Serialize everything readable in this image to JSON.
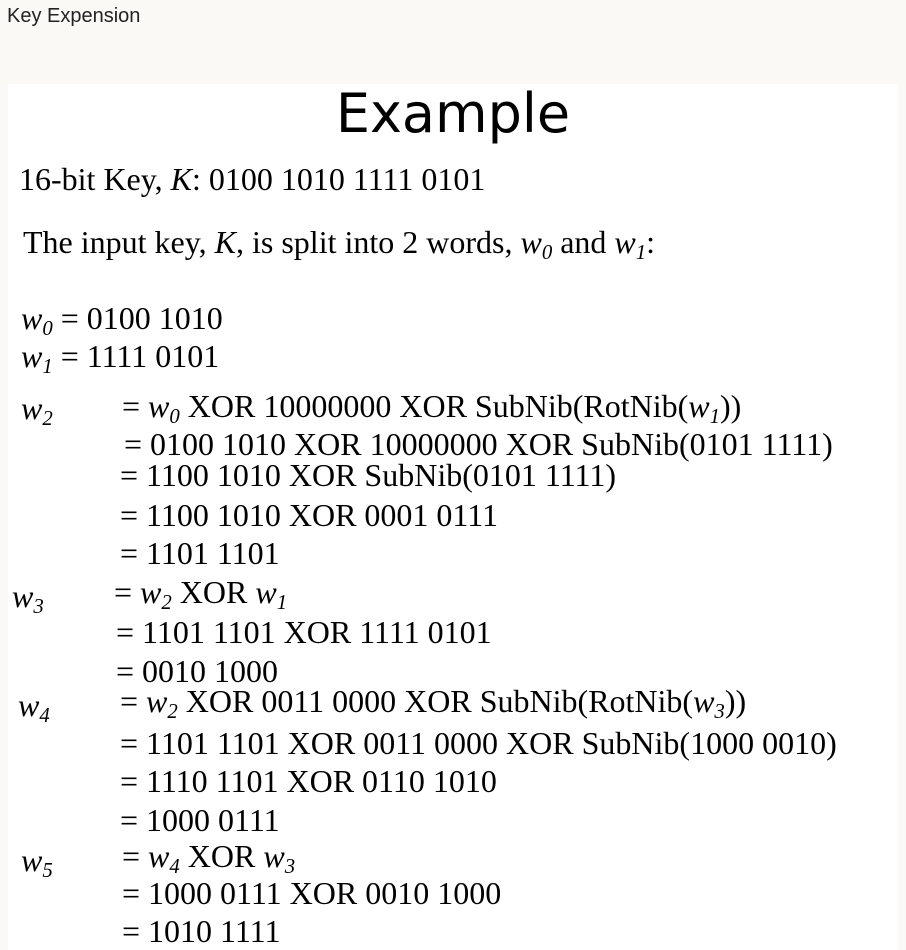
{
  "header": {
    "title": "Key Expension"
  },
  "slide": {
    "title": "Example",
    "key_line": {
      "prefix": "16-bit Key, ",
      "var": "K",
      "value": ": 0100 1010 1111 0101"
    },
    "split_line": {
      "p1": "The input key, ",
      "var_k": "K",
      "p2": ", is split into 2 words, ",
      "w0_base": "w",
      "w0_sub": "0",
      "p3": " and ",
      "w1_base": "w",
      "w1_sub": "1",
      "p4": ":"
    },
    "w0_def": {
      "base": "w",
      "sub": "0",
      "value": " = 0100 1010"
    },
    "w1_def": {
      "base": "w",
      "sub": "1",
      "value": " = 1111 0101"
    },
    "w2": {
      "label_base": "w",
      "label_sub": "2",
      "line1": {
        "a": "= ",
        "v1_base": "w",
        "v1_sub": "0",
        "b": " XOR 10000000 XOR SubNib(RotNib(",
        "v2_base": "w",
        "v2_sub": "1",
        "c": "))"
      },
      "line2": "= 0100 1010 XOR 10000000 XOR SubNib(0101 1111)",
      "line3": "= 1100 1010 XOR SubNib(0101 1111)",
      "line4": "= 1100 1010 XOR 0001 0111",
      "line5": "= 1101 1101"
    },
    "w3": {
      "label_base": "w",
      "label_sub": "3",
      "line1": {
        "a": "= ",
        "v1_base": "w",
        "v1_sub": "2",
        "b": " XOR ",
        "v2_base": "w",
        "v2_sub": "1"
      },
      "line2": "= 1101 1101 XOR 1111 0101",
      "line3": "= 0010 1000"
    },
    "w4": {
      "label_base": "w",
      "label_sub": "4",
      "line1": {
        "a": "= ",
        "v1_base": "w",
        "v1_sub": "2",
        "b": " XOR 0011 0000 XOR SubNib(RotNib(",
        "v2_base": "w",
        "v2_sub": "3",
        "c": "))"
      },
      "line2": "= 1101 1101 XOR 0011 0000 XOR SubNib(1000 0010)",
      "line3": "= 1110 1101 XOR 0110 1010",
      "line4": "= 1000 0111"
    },
    "w5": {
      "label_base": "w",
      "label_sub": "5",
      "line1": {
        "a": "= ",
        "v1_base": "w",
        "v1_sub": "4",
        "b": " XOR ",
        "v2_base": "w",
        "v2_sub": "3"
      },
      "line2": "= 1000 0111 XOR 0010 1000",
      "line3": "= 1010 1111"
    }
  }
}
